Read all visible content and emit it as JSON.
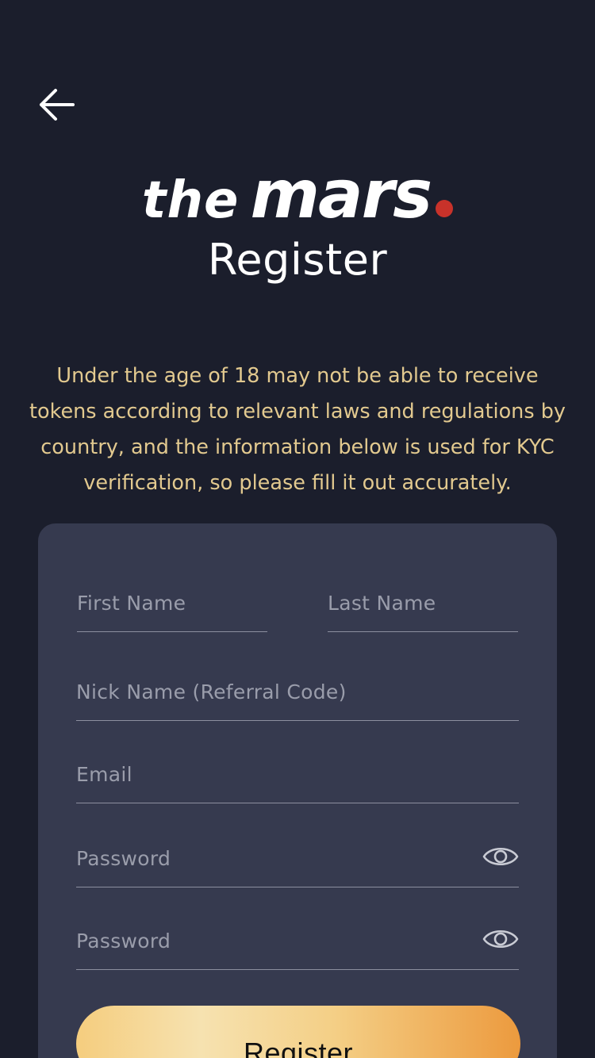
{
  "header": {
    "back_icon": "arrow-left-icon"
  },
  "logo": {
    "the": "the",
    "mars": "mars",
    "dot_color": "#c8322a"
  },
  "page": {
    "title": "Register",
    "notice": "Under the age of 18 may not be able to receive tokens according to relevant laws and regulations by country, and the information below is used for KYC verification, so please fill it out accurately."
  },
  "form": {
    "first_name": {
      "placeholder": "First Name",
      "value": ""
    },
    "last_name": {
      "placeholder": "Last Name",
      "value": ""
    },
    "nick_name": {
      "placeholder": "Nick Name (Referral Code)",
      "value": ""
    },
    "email": {
      "placeholder": "Email",
      "value": ""
    },
    "password": {
      "placeholder": "Password",
      "value": "",
      "toggle_icon": "eye-icon"
    },
    "password_confirm": {
      "placeholder": "Password",
      "value": "",
      "toggle_icon": "eye-icon"
    },
    "submit_label": "Register"
  },
  "colors": {
    "background": "#1b1e2c",
    "card": "#363a4f",
    "notice_text": "#e2c98f",
    "button_gradient_start": "#f5cd7e",
    "button_gradient_end": "#ec9a3e"
  }
}
